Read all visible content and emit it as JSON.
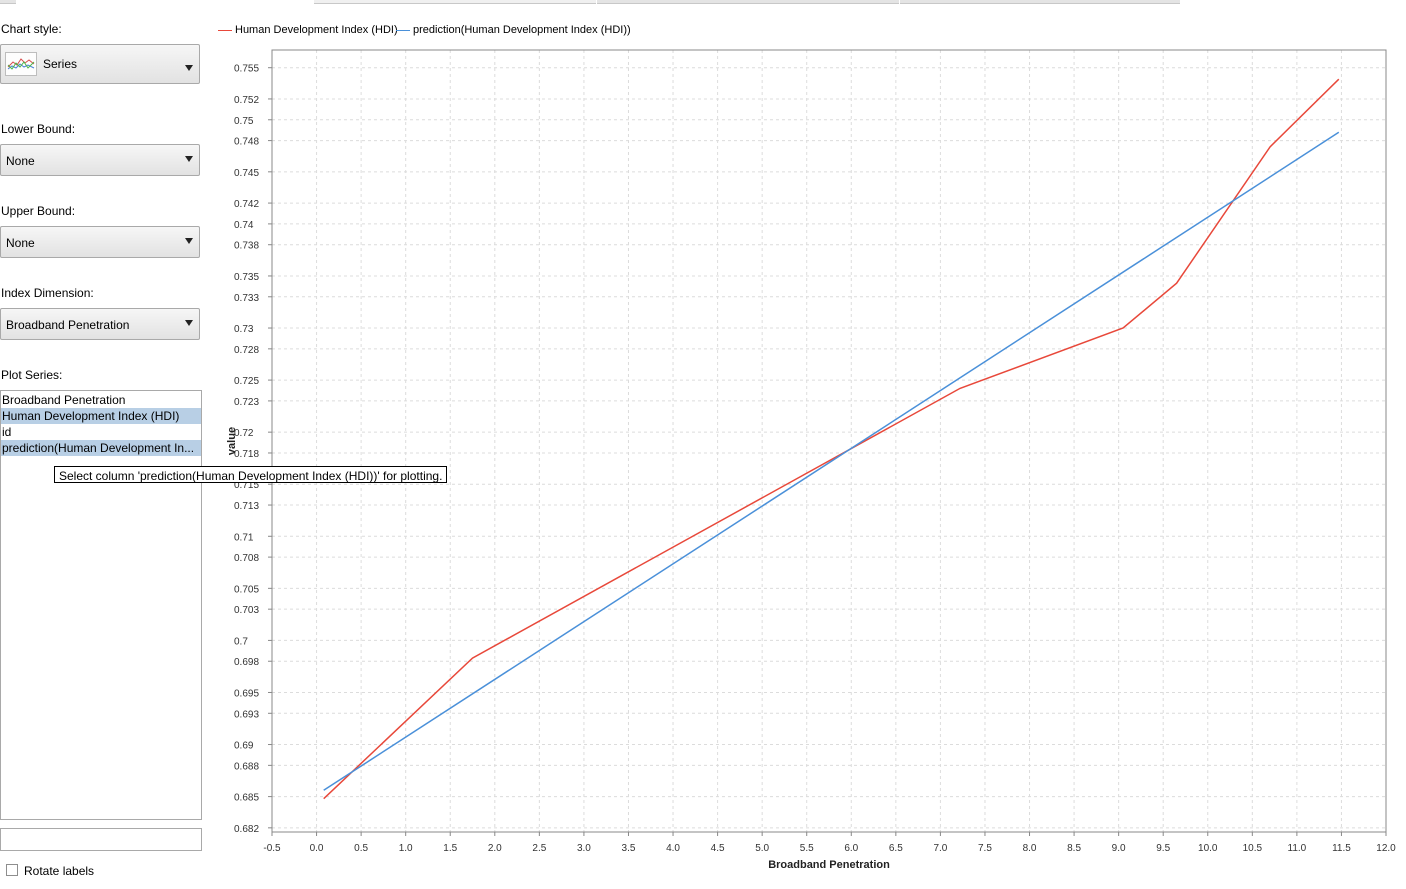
{
  "panel": {
    "chart_style_label": "Chart style:",
    "chart_style_value": "Series",
    "lower_bound_label": "Lower Bound:",
    "lower_bound_value": "None",
    "upper_bound_label": "Upper Bound:",
    "upper_bound_value": "None",
    "index_dimension_label": "Index Dimension:",
    "index_dimension_value": "Broadband Penetration",
    "plot_series_label": "Plot Series:",
    "plot_series_items": [
      {
        "label": "Broadband Penetration",
        "selected": false
      },
      {
        "label": "Human Development Index (HDI)",
        "selected": true
      },
      {
        "label": "id",
        "selected": false
      },
      {
        "label": "prediction(Human Development In...",
        "selected": true
      }
    ],
    "filter_value": "",
    "rotate_labels_label": "Rotate labels",
    "rotate_labels_checked": false,
    "tooltip": "Select column 'prediction(Human Development Index (HDI))' for plotting."
  },
  "chart_data": {
    "type": "line",
    "xlabel": "Broadband Penetration",
    "ylabel": "value",
    "xlim": [
      -0.5,
      12.0
    ],
    "ylim": [
      0.6816,
      0.7567
    ],
    "x_ticks": [
      "-0.5",
      "0.0",
      "0.5",
      "1.0",
      "1.5",
      "2.0",
      "2.5",
      "3.0",
      "3.5",
      "4.0",
      "4.5",
      "5.0",
      "5.5",
      "6.0",
      "6.5",
      "7.0",
      "7.5",
      "8.0",
      "8.5",
      "9.0",
      "9.5",
      "10.0",
      "10.5",
      "11.0",
      "11.5",
      "12.0"
    ],
    "y_ticks": [
      "0.682",
      "0.685",
      "0.688",
      "0.69",
      "0.693",
      "0.695",
      "0.698",
      "0.7",
      "0.703",
      "0.705",
      "0.708",
      "0.71",
      "0.713",
      "0.715",
      "0.718",
      "0.72",
      "0.723",
      "0.725",
      "0.728",
      "0.73",
      "0.733",
      "0.735",
      "0.738",
      "0.74",
      "0.742",
      "0.745",
      "0.748",
      "0.75",
      "0.752",
      "0.755"
    ],
    "grid": true,
    "legend_position": "top-left",
    "series": [
      {
        "name": "Human Development Index (HDI)",
        "color": "#e8483a",
        "points": [
          [
            0.08,
            0.6848
          ],
          [
            1.75,
            0.6983
          ],
          [
            7.22,
            0.7242
          ],
          [
            9.05,
            0.73
          ],
          [
            9.65,
            0.7343
          ],
          [
            10.7,
            0.7474
          ],
          [
            11.47,
            0.7539
          ]
        ]
      },
      {
        "name": "prediction(Human Development Index (HDI))",
        "color": "#4a90d9",
        "points": [
          [
            0.08,
            0.6856
          ],
          [
            11.47,
            0.7488
          ]
        ]
      }
    ]
  }
}
